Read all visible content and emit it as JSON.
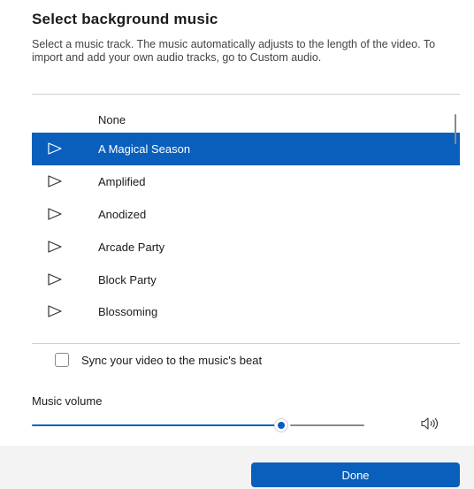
{
  "dialog": {
    "title": "Select background music",
    "description": "Select a music track. The music automatically adjusts to the length of the video. To import and add your own audio tracks, go to Custom audio."
  },
  "tracks": [
    {
      "label": "None",
      "has_play": false,
      "selected": false
    },
    {
      "label": "A Magical Season",
      "has_play": true,
      "selected": true
    },
    {
      "label": "Amplified",
      "has_play": true,
      "selected": false
    },
    {
      "label": "Anodized",
      "has_play": true,
      "selected": false
    },
    {
      "label": "Arcade Party",
      "has_play": true,
      "selected": false
    },
    {
      "label": "Block Party",
      "has_play": true,
      "selected": false
    },
    {
      "label": "Blossoming",
      "has_play": true,
      "selected": false
    }
  ],
  "sync": {
    "label": "Sync your video to the music's beat",
    "checked": false
  },
  "volume": {
    "label": "Music volume",
    "value_fraction": 0.75,
    "icon": "speaker-icon"
  },
  "footer": {
    "done_label": "Done"
  },
  "colors": {
    "accent": "#0a5fbd",
    "footer_bg": "#f3f3f3"
  }
}
